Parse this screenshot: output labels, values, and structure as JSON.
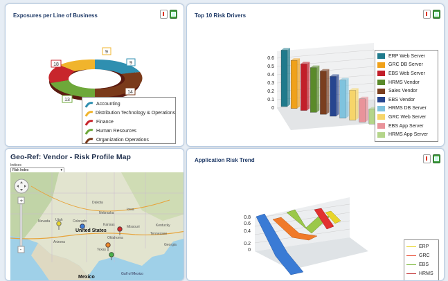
{
  "panel1": {
    "title": "Exposures per Line of Business",
    "slices": [
      {
        "label": "Accounting",
        "value": 9,
        "color": "#2f8fb0"
      },
      {
        "label": "Distribution Technology & Operations",
        "value": 9,
        "color": "#f0b42c"
      },
      {
        "label": "Finance",
        "value": 18,
        "color": "#c8262c"
      },
      {
        "label": "Human Resources",
        "value": 13,
        "color": "#6ea83a"
      },
      {
        "label": "Organization Operations",
        "value": 14,
        "color": "#7a3a1a"
      }
    ]
  },
  "panel2": {
    "title": "Top 10 Risk Drivers",
    "chart_data": {
      "type": "bar",
      "categories": [
        "ERP Web Server",
        "GRC DB Server",
        "EBS Web Server",
        "HRMS Vendor",
        "Sales Vendor",
        "EBS Vendor",
        "HRMS DB Server",
        "GRC Web Server",
        "EBS App Server",
        "HRMS App Server"
      ],
      "values": [
        0.68,
        0.58,
        0.56,
        0.54,
        0.52,
        0.48,
        0.46,
        0.36,
        0.28,
        0.18
      ],
      "colors": [
        "#1f7a8c",
        "#f0a11a",
        "#c21e2a",
        "#5a8a2a",
        "#7a3e1f",
        "#26458f",
        "#7fc3de",
        "#f6d56a",
        "#e9939a",
        "#b4d58a"
      ],
      "ylim": [
        0,
        0.6
      ],
      "yticks": [
        "0",
        "0.1",
        "0.2",
        "0.3",
        "0.4",
        "0.5",
        "0.6"
      ]
    }
  },
  "panel3": {
    "title": "Geo-Ref: Vendor - Risk Profile Map",
    "select_label": "Indices",
    "select_value": "Risk Index",
    "map_labels": [
      {
        "text": "United States"
      },
      {
        "text": "Mexico"
      },
      {
        "text": "Dakota"
      },
      {
        "text": "Iowa"
      },
      {
        "text": "Kansas"
      },
      {
        "text": "Missouri"
      },
      {
        "text": "Texas"
      },
      {
        "text": "Oklahoma"
      },
      {
        "text": "Arizona"
      },
      {
        "text": "Nevada"
      },
      {
        "text": "Colorado"
      },
      {
        "text": "Utah"
      },
      {
        "text": "Tennessee"
      },
      {
        "text": "Kentucky"
      },
      {
        "text": "Nebraska"
      },
      {
        "text": "Georgia"
      },
      {
        "text": "Gulf of Mexico"
      }
    ]
  },
  "panel4": {
    "title": "Application Risk Trend",
    "chart_data": {
      "type": "line",
      "yticks": [
        "0",
        "0.2",
        "0.4",
        "0.6",
        "0.8"
      ],
      "series": [
        {
          "name": "ERP",
          "color": "#e8d52a"
        },
        {
          "name": "GRC",
          "color": "#e8442a"
        },
        {
          "name": "EBS",
          "color": "#7ab83a"
        },
        {
          "name": "HRMS",
          "color": "#c0282a"
        }
      ]
    }
  }
}
